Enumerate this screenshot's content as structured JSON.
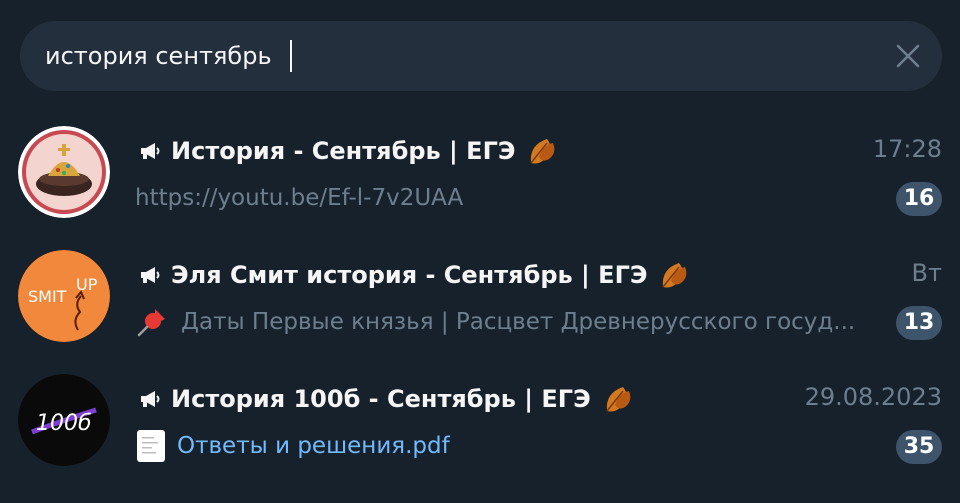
{
  "search": {
    "value": "история сентябрь",
    "placeholder": ""
  },
  "results": [
    {
      "title": "История - Сентябрь | ЕГЭ",
      "time": "17:28",
      "preview": "https://youtu.be/Ef-l-7v2UAA",
      "unread": "16",
      "avatar": "hat-avatar"
    },
    {
      "title": "Эля Смит история - Сентябрь | ЕГЭ",
      "time": "Вт",
      "preview": "Даты Первые князья | Расцвет Древнерусского госуд...",
      "unread": "13",
      "avatar": "smitup-avatar",
      "avatar_text": "SMIT",
      "avatar_text2": "UP"
    },
    {
      "title": "История 100б - Сентябрь | ЕГЭ",
      "time": "29.08.2023",
      "preview": "Ответы и решения.pdf",
      "unread": "35",
      "avatar": "100b-avatar",
      "avatar_text": "100б"
    }
  ],
  "colors": {
    "background": "#17212b",
    "search_bg": "#242f3d",
    "muted": "#6d7f8f",
    "badge": "#3e546a",
    "link": "#71baff"
  }
}
